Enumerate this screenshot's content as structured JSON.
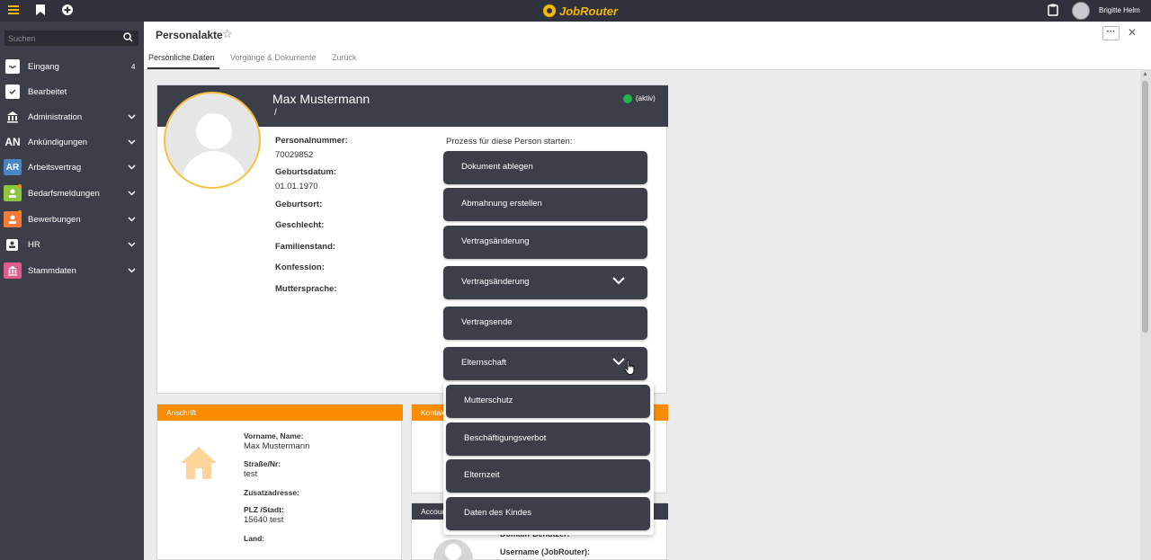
{
  "topbar": {
    "logo_text": "JobRouter",
    "user_name": "Brigitte Helm"
  },
  "sidebar": {
    "search_placeholder": "Suchen",
    "items": [
      {
        "label": "Eingang",
        "count": "4",
        "icon_text": "",
        "icon_color": "#ffffff"
      },
      {
        "label": "Bearbeitet",
        "icon_text": "",
        "icon_color": "#ffffff"
      },
      {
        "label": "Administration",
        "icon_text": "",
        "icon_color": "#ffffff"
      },
      {
        "label": "Ankündigungen",
        "icon_text": "AN",
        "icon_color": "#3c3f4a"
      },
      {
        "label": "Arbeitsvertrag",
        "icon_text": "AR",
        "icon_color": "#4a86c5"
      },
      {
        "label": "Bedarfsmeldungen",
        "icon_text": "",
        "icon_color": "#8dc63f"
      },
      {
        "label": "Bewerbungen",
        "icon_text": "",
        "icon_color": "#f47b3a"
      },
      {
        "label": "HR",
        "icon_text": "",
        "icon_color": "#ffffff"
      },
      {
        "label": "Stammdaten",
        "icon_text": "",
        "icon_color": "#e05a8c"
      }
    ]
  },
  "page": {
    "title": "Personalakte",
    "tabs": [
      "Persönliche Daten",
      "Vorgänge & Dokumente",
      "Zurück"
    ]
  },
  "person": {
    "name": "Max Mustermann",
    "subtitle": "/",
    "status": "(aktiv)",
    "status_color": "#22b14c",
    "fields": {
      "personalnummer_label": "Personalnummer:",
      "personalnummer_value": "70029852",
      "geburtsdatum_label": "Geburtsdatum:",
      "geburtsdatum_value": "01.01.1970",
      "geburtsort_label": "Geburtsort:",
      "geschlecht_label": "Geschlecht:",
      "familienstand_label": "Familienstand:",
      "konfession_label": "Konfession:",
      "muttersprache_label": "Muttersprache:"
    }
  },
  "process": {
    "label": "Prozess für diese Person starten:",
    "buttons": [
      "Dokument ablegen",
      "Abmahnung erstellen",
      "Vertragsänderung",
      "Vertragsänderung",
      "Vertragsende",
      "Elternschaft"
    ],
    "submenu": [
      "Mutterschutz",
      "Beschäftigungsverbot",
      "Elternzeit",
      "Daten des Kindes"
    ]
  },
  "address": {
    "title": "Anschrift",
    "name_label": "Vorname, Name:",
    "name_value": "Max Mustermann",
    "street_label": "Straße/Nr:",
    "street_value": "test",
    "extra_label": "Zusatzadresse:",
    "city_label": "PLZ /Stadt:",
    "city_value": "15640 test",
    "country_label": "Land:"
  },
  "contact": {
    "title": "Kontakt"
  },
  "account": {
    "title": "Account",
    "domain_label": "Domain-Benutzer:",
    "username_label": "Username (JobRouter):"
  },
  "colors": {
    "sidebar_bg": "#3c3f4a",
    "topbar_bg": "#2f323c",
    "accent_orange": "#fb8c00",
    "logo_yellow": "#f5b800"
  }
}
